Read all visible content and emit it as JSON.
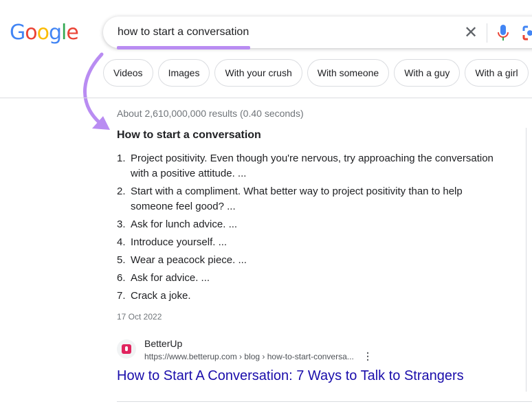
{
  "logo": {
    "text": "Google",
    "colors": [
      "#4285f4",
      "#ea4335",
      "#fbbc05",
      "#4285f4",
      "#34a853",
      "#ea4335"
    ]
  },
  "search": {
    "query": "how to start a conversation",
    "clear_icon": "close-icon",
    "mic_icon": "mic-icon",
    "lens_icon": "camera-lens-icon"
  },
  "chips": [
    "Videos",
    "Images",
    "With your crush",
    "With someone",
    "With a guy",
    "With a girl"
  ],
  "results_stats": "About 2,610,000,000 results (0.40 seconds)",
  "snippet": {
    "title": "How to start a conversation",
    "items": [
      {
        "n": "1.",
        "text": "Project positivity. Even though you're nervous, try approaching the conversation with a positive attitude. ..."
      },
      {
        "n": "2.",
        "text": "Start with a compliment. What better way to project positivity than to help someone feel good? ..."
      },
      {
        "n": "3.",
        "text": "Ask for lunch advice. ..."
      },
      {
        "n": "4.",
        "text": "Introduce yourself. ..."
      },
      {
        "n": "5.",
        "text": "Wear a peacock piece. ..."
      },
      {
        "n": "6.",
        "text": "Ask for advice. ..."
      },
      {
        "n": "7.",
        "text": "Crack a joke."
      }
    ],
    "date": "17 Oct 2022"
  },
  "result": {
    "site": "BetterUp",
    "url": "https://www.betterup.com › blog › how-to-start-conversa...",
    "title": "How to Start A Conversation: 7 Ways to Talk to Strangers",
    "more_icon": "three-dots-vertical-icon"
  },
  "annotation_color": "#b98cf2"
}
